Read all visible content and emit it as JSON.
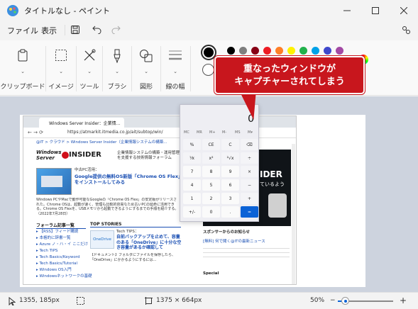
{
  "window": {
    "title": "タイトルなし - ペイント",
    "minimize_icon": "minimize-icon",
    "maximize_icon": "maximize-icon",
    "close_icon": "close-icon"
  },
  "menu": {
    "file": "ファイル",
    "view": "表示",
    "save_icon": "save-icon",
    "undo_icon": "undo-icon",
    "redo_icon": "redo-icon",
    "settings_icon": "settings-icon"
  },
  "ribbon": {
    "clipboard": "クリップボード",
    "image": "イメージ",
    "tools": "ツール",
    "brushes": "ブラシ",
    "shapes": "図形",
    "size": "線の幅"
  },
  "colors": {
    "primary": "#000000",
    "secondary": "#ffffff",
    "palette": [
      "#000000",
      "#7f7f7f",
      "#880015",
      "#ed1c24",
      "#ff7f27",
      "#fff200",
      "#22b14c",
      "#00a2e8",
      "#3f48cc",
      "#a349a4"
    ]
  },
  "callout": {
    "line1": "重なったウィンドウが",
    "line2": "キャプチャーされてしまう",
    "color": "#c8161d"
  },
  "captured_browser": {
    "tab_title": "Windows Server Insider：企業情...",
    "url": "https://atmarkit.itmedia.co.jp/ait/subtop/win/",
    "breadcrumb": "@IT > クラウド > Windows Server Insider（企業情報システムの構築...",
    "logo_line1": "Windows",
    "logo_line2": "Server",
    "logo_insider": "INSIDER",
    "tagline": "企業情報システムの構築・運用管理を支援する技術情報フォーラム",
    "feature_label": "中古PC活用：",
    "feature_title": "Google提供の無料OS新版「Chrome OS Flex」をインストールしてみる",
    "feature_body": "Windows PCやMacで動作可能なGoogleの「Chrome OS Flex」の安定版がリリースされた。Chrome OSは、起動が速く、管理も比較的容易なため古いPCの延命に活用できる。Chrome OS Flexを、USBメモリから起動できるようにするまでの手順を紹介する。（2022年7月28日）",
    "left_heading": "フォーラム記事一覧",
    "left_items": [
      "【RSS】フィード購読",
      "本格的に辞書一覧",
      "Azure ノ・ハ・イ ここだけ",
      "Tech TIPS",
      "Tech Basics/Keyword",
      "Tech Basics/Tutorial",
      "Windows OS入門",
      "Windowsネットワークの基礎"
    ],
    "top_heading": "TOP STORIES",
    "story_label": "Tech TIPS：",
    "story_title": "自前バックアップを止めて、容量のある「OneDrive」に十分な空き容量があるか確認して",
    "story_body": "【ドキュメント】フォルダにファイルを保存したら、「OneDrive」にかかるようにするには…",
    "ad_text": "IDER",
    "ad_sub": "ているよう",
    "sponsor": "スポンサーからのお知らせ",
    "news": "[無料] 何で聞く@ITの最新ニュース",
    "special": "Special"
  },
  "calculator": {
    "display": "0",
    "memory": [
      "MC",
      "MR",
      "M+",
      "M-",
      "MS",
      "M▾"
    ],
    "keys": [
      "%",
      "CE",
      "C",
      "⌫",
      "⅟x",
      "x²",
      "²√x",
      "÷",
      "7",
      "8",
      "9",
      "×",
      "4",
      "5",
      "6",
      "−",
      "1",
      "2",
      "3",
      "+",
      "+/-",
      "0",
      ".",
      "="
    ],
    "equals_color": "#0b62d6"
  },
  "status": {
    "cursor_pos": "1355, 185px",
    "canvas_size": "1375 × 664px",
    "zoom": "50%"
  }
}
